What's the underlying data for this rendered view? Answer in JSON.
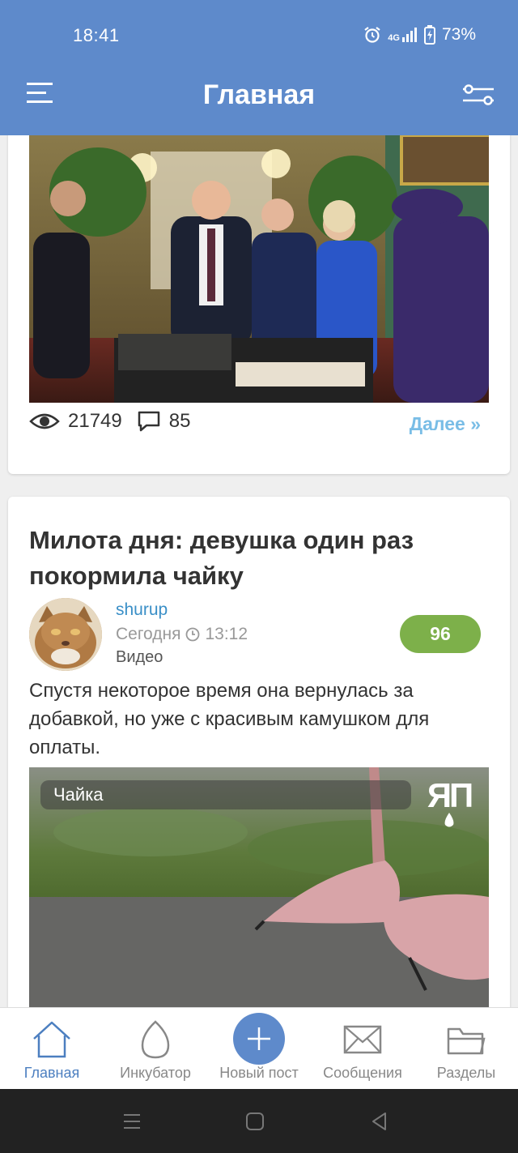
{
  "status_bar": {
    "time": "18:41",
    "network": "4G",
    "battery": "73%"
  },
  "header": {
    "title": "Главная",
    "menu_icon": "hamburger-menu-icon",
    "filter_icon": "filter-sliders-icon"
  },
  "post1": {
    "views": "21749",
    "comments": "85",
    "more_label": "Далее »"
  },
  "post2": {
    "title": "Милота дня: девушка один раз покормила чайку",
    "author": "shurup",
    "date": "Сегодня",
    "time": "13:12",
    "category": "Видео",
    "rating": "96",
    "excerpt": "Спустя некоторое время она вернулась за добавкой, но уже с красивым камушком для оплаты.",
    "video_title": "Чайка",
    "video_logo": "ЯП"
  },
  "bottom_nav": {
    "home": "Главная",
    "incubator": "Инкубатор",
    "new_post": "Новый пост",
    "messages": "Сообщения",
    "sections": "Разделы"
  },
  "colors": {
    "header_bg": "#5e8acb",
    "rating_bg": "#7db04a",
    "link": "#79bde6",
    "author": "#3a8fc7"
  }
}
